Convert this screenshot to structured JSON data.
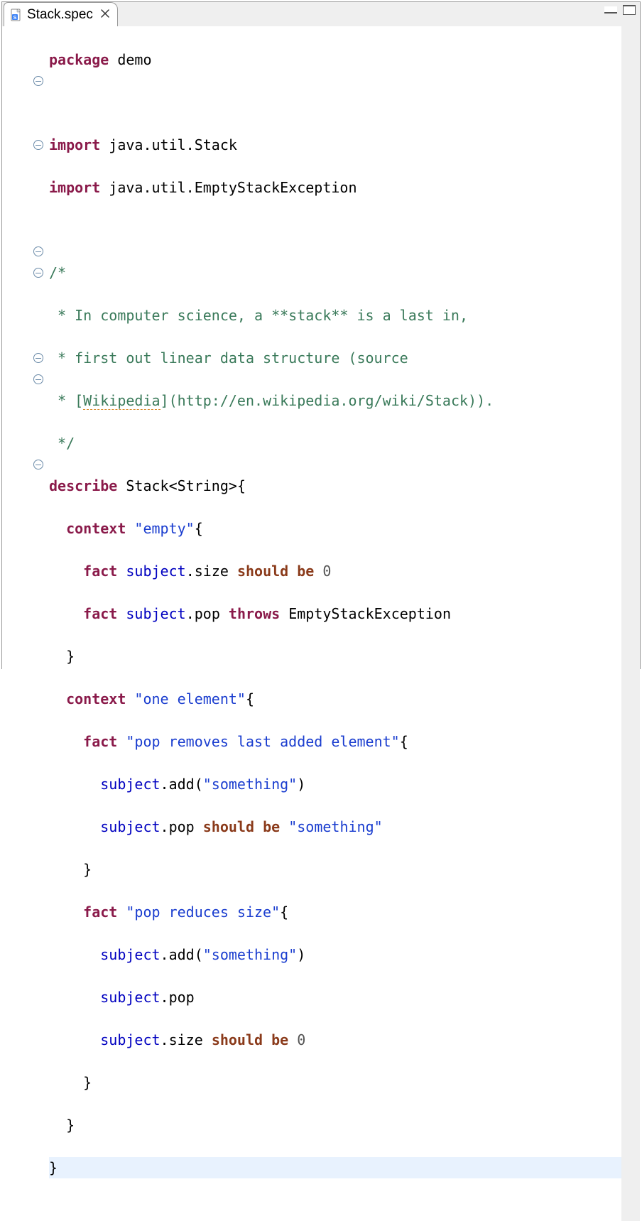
{
  "tab": {
    "filename": "Stack.spec",
    "file_icon": "spec-file-icon",
    "close": "✕"
  },
  "toolbar": {
    "minimize": "minimize",
    "maximize": "maximize"
  },
  "gutter": {
    "fold_label": "-"
  },
  "code": {
    "l1": {
      "kw": "package",
      "rest": " demo"
    },
    "l2": "",
    "l3": {
      "kw": "import",
      "rest": " java.util.Stack"
    },
    "l4": {
      "kw": "import",
      "rest": " java.util.EmptyStackException"
    },
    "l5": "",
    "l6": "/*",
    "l7_a": " * In computer science, a **stack** is a last in,",
    "l8_a": " * first out linear data structure (source",
    "l9_a": " * [",
    "l9_w": "Wikipedia",
    "l9_b": "](http://en.wikipedia.org/wiki/Stack)).",
    "l10": " */",
    "l11": {
      "kw": "describe",
      "rest": " Stack<String>{"
    },
    "l12": {
      "pad": "  ",
      "kw": "context",
      "str": " \"empty\"",
      "rest": "{"
    },
    "l13": {
      "pad": "    ",
      "kw": "fact ",
      "field": "subject",
      "dot": ".",
      "mem": "size",
      "sp": " ",
      "should": "should",
      "sp2": " ",
      "be": "be",
      "sp3": " ",
      "num": "0"
    },
    "l14": {
      "pad": "    ",
      "kw": "fact ",
      "field": "subject",
      "dot": ".",
      "mem": "pop",
      "sp": " ",
      "throws": "throws",
      "sp2": " ",
      "ex": "EmptyStackException"
    },
    "l15": "  }",
    "l16": {
      "pad": "  ",
      "kw": "context",
      "str": " \"one element\"",
      "rest": "{"
    },
    "l17": {
      "pad": "    ",
      "kw": "fact ",
      "str": "\"pop removes last added element\"",
      "rest": "{"
    },
    "l18": {
      "pad": "      ",
      "field": "subject",
      "dot": ".",
      "mem": "add",
      "p1": "(",
      "str": "\"something\"",
      "p2": ")"
    },
    "l19": {
      "pad": "      ",
      "field": "subject",
      "dot": ".",
      "mem": "pop",
      "sp": " ",
      "should": "should",
      "sp2": " ",
      "be": "be",
      "sp3": " ",
      "str": "\"something\""
    },
    "l20": "    }",
    "l21": {
      "pad": "    ",
      "kw": "fact ",
      "str": "\"pop reduces size\"",
      "rest": "{"
    },
    "l22": {
      "pad": "      ",
      "field": "subject",
      "dot": ".",
      "mem": "add",
      "p1": "(",
      "str": "\"something\"",
      "p2": ")"
    },
    "l23": {
      "pad": "      ",
      "field": "subject",
      "dot": ".",
      "mem": "pop"
    },
    "l24": {
      "pad": "      ",
      "field": "subject",
      "dot": ".",
      "mem": "size",
      "sp": " ",
      "should": "should",
      "sp2": " ",
      "be": "be",
      "sp3": " ",
      "num": "0"
    },
    "l25": "    }",
    "l26": "  }",
    "l27": "}"
  },
  "fold_lines": [
    3,
    6,
    11,
    12,
    16,
    17,
    21
  ]
}
